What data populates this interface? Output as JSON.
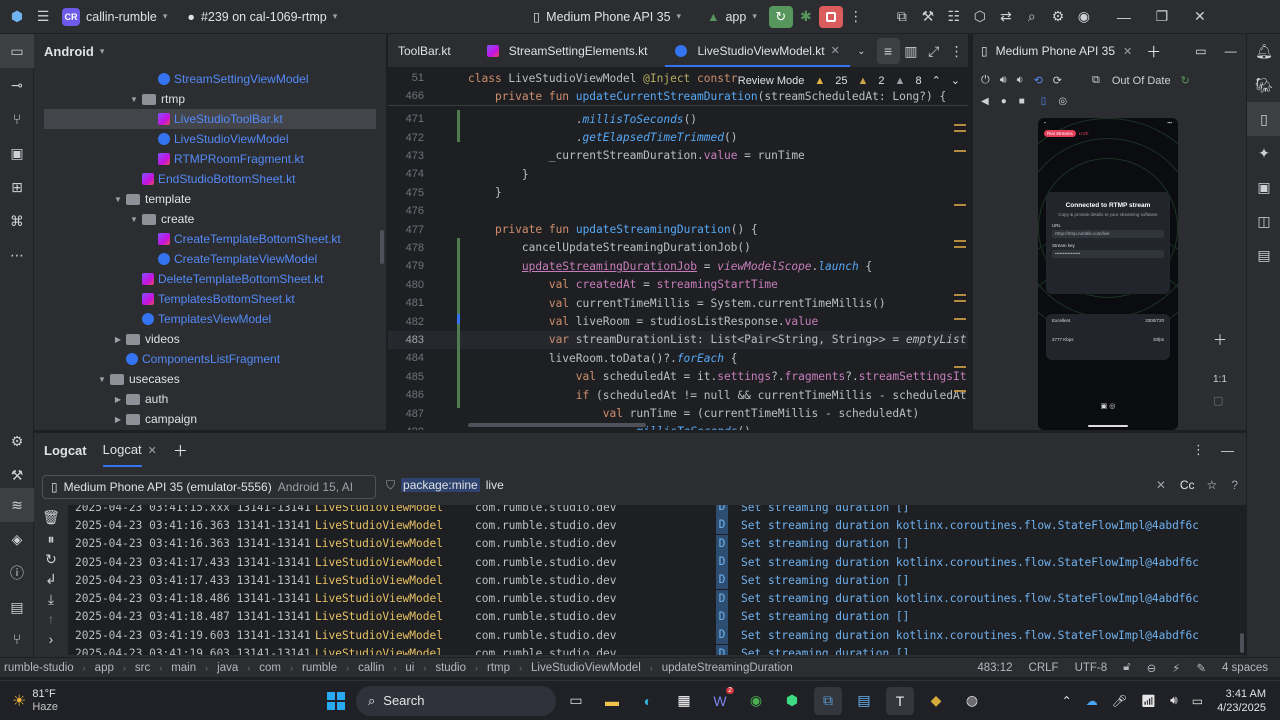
{
  "titlebar": {
    "project_badge": "CR",
    "project_name": "callin-rumble",
    "vcs": "#239 on cal-1069-rtmp",
    "device": "Medium Phone API 35",
    "run_config": "app",
    "window_buttons": [
      "minimize",
      "maximize",
      "close"
    ]
  },
  "project_panel": {
    "title": "Android",
    "tree": [
      {
        "label": "StreamSettingViewModel",
        "kind": "kt-class",
        "depth": 3,
        "selected": false
      },
      {
        "label": "rtmp",
        "kind": "folder",
        "depth": 2,
        "open": true
      },
      {
        "label": "LiveStudioToolBar.kt",
        "kind": "kt",
        "depth": 3,
        "selected": true
      },
      {
        "label": "LiveStudioViewModel",
        "kind": "kt-class",
        "depth": 3
      },
      {
        "label": "RTMPRoomFragment.kt",
        "kind": "kt",
        "depth": 3
      },
      {
        "label": "EndStudioBottomSheet.kt",
        "kind": "kt",
        "depth": 2
      },
      {
        "label": "template",
        "kind": "folder",
        "depth": 1,
        "open": true
      },
      {
        "label": "create",
        "kind": "folder",
        "depth": 2,
        "open": true
      },
      {
        "label": "CreateTemplateBottomSheet.kt",
        "kind": "kt",
        "depth": 3
      },
      {
        "label": "CreateTemplateViewModel",
        "kind": "kt-class",
        "depth": 3
      },
      {
        "label": "DeleteTemplateBottomSheet.kt",
        "kind": "kt",
        "depth": 2
      },
      {
        "label": "TemplatesBottomSheet.kt",
        "kind": "kt",
        "depth": 2
      },
      {
        "label": "TemplatesViewModel",
        "kind": "kt-class",
        "depth": 2
      },
      {
        "label": "videos",
        "kind": "folder",
        "depth": 1,
        "open": false
      },
      {
        "label": "ComponentsListFragment",
        "kind": "kt-class",
        "depth": 1
      },
      {
        "label": "usecases",
        "kind": "folder",
        "depth": 0,
        "open": true
      },
      {
        "label": "auth",
        "kind": "folder",
        "depth": 1,
        "open": false
      },
      {
        "label": "campaign",
        "kind": "folder",
        "depth": 1,
        "open": false
      }
    ]
  },
  "editor": {
    "tabs": [
      {
        "label": "ToolBar.kt",
        "active": false
      },
      {
        "label": "StreamSettingElements.kt",
        "active": false
      },
      {
        "label": "LiveStudioViewModel.kt",
        "active": true
      }
    ],
    "mode": "Review Mode",
    "warnings": "25",
    "weak_warnings": "2",
    "infos": "8",
    "sticky_lines": [
      {
        "n": "51",
        "text": "class LiveStudioViewModel @Inject constructor"
      },
      {
        "n": "466",
        "text": "    private fun updateCurrentStreamDuration(streamScheduledAt: Long?) {"
      }
    ],
    "lines": [
      {
        "n": "471",
        "text": "                .millisToSeconds()"
      },
      {
        "n": "472",
        "text": "                .getElapsedTimeTrimmed()"
      },
      {
        "n": "473",
        "text": "            _currentStreamDuration.value = runTime"
      },
      {
        "n": "474",
        "text": "        }"
      },
      {
        "n": "475",
        "text": "    }"
      },
      {
        "n": "476",
        "text": ""
      },
      {
        "n": "477",
        "text": "    private fun updateStreamingDuration() {"
      },
      {
        "n": "478",
        "text": "        cancelUpdateStreamingDurationJob()"
      },
      {
        "n": "479",
        "text": "        updateStreamingDurationJob = viewModelScope.launch {"
      },
      {
        "n": "480",
        "text": "            val createdAt = streamingStartTime"
      },
      {
        "n": "481",
        "text": "            val currentTimeMillis = System.currentTimeMillis()"
      },
      {
        "n": "482",
        "text": "            val liveRoom = studiosListResponse.value"
      },
      {
        "n": "483",
        "text": "            var streamDurationList: List<Pair<String, String>> = emptyList("
      },
      {
        "n": "484",
        "text": "            liveRoom.toData()?.forEach {"
      },
      {
        "n": "485",
        "text": "                val scheduledAt = it.settings?.fragments?.streamSettingsIt"
      },
      {
        "n": "486",
        "text": "                if (scheduledAt != null && currentTimeMillis - scheduledAt"
      },
      {
        "n": "487",
        "text": "                    val runTime = (currentTimeMillis - scheduledAt)"
      },
      {
        "n": "488",
        "text": "                        .millisToSeconds()"
      }
    ]
  },
  "device_panel": {
    "tab_label": "Medium Phone API 35",
    "status": "Out Of Date",
    "zoom_label": "1:1",
    "phone": {
      "header_pills": [
        "Rial Streams",
        "LIVE"
      ],
      "card_title": "Connected to RTMP stream",
      "card_sub": "Copy & provide details to your streaming software",
      "url_label": "URL",
      "url_value": "rtmp://rtmp.rumble.com/live",
      "key_label": "Stream key",
      "key_value": "••••••••••••••••",
      "stats": [
        {
          "label": "Excellent",
          "value": "3300/720"
        },
        {
          "label": "2777 Kbps",
          "value": "30fps"
        }
      ]
    }
  },
  "logcat": {
    "tabs": [
      "Logcat",
      "Logcat"
    ],
    "device_selector": "Medium Phone API 35 (emulator-5556)",
    "device_meta": "Android 15, AI",
    "filter_key": "package:mine",
    "filter_term": "live",
    "case_toggle": "Cc",
    "rows": [
      {
        "ts": "2025-04-23 03:41:15.xxx",
        "pid": "13141-13141",
        "tag": "LiveStudioViewModel",
        "pkg": "com.rumble.studio.dev",
        "lvl": "D",
        "msg": "Set streaming duration []"
      },
      {
        "ts": "2025-04-23 03:41:16.363",
        "pid": "13141-13141",
        "tag": "LiveStudioViewModel",
        "pkg": "com.rumble.studio.dev",
        "lvl": "D",
        "msg": "Set streaming duration kotlinx.coroutines.flow.StateFlowImpl@4abdf6c"
      },
      {
        "ts": "2025-04-23 03:41:16.363",
        "pid": "13141-13141",
        "tag": "LiveStudioViewModel",
        "pkg": "com.rumble.studio.dev",
        "lvl": "D",
        "msg": "Set streaming duration []"
      },
      {
        "ts": "2025-04-23 03:41:17.433",
        "pid": "13141-13141",
        "tag": "LiveStudioViewModel",
        "pkg": "com.rumble.studio.dev",
        "lvl": "D",
        "msg": "Set streaming duration kotlinx.coroutines.flow.StateFlowImpl@4abdf6c"
      },
      {
        "ts": "2025-04-23 03:41:17.433",
        "pid": "13141-13141",
        "tag": "LiveStudioViewModel",
        "pkg": "com.rumble.studio.dev",
        "lvl": "D",
        "msg": "Set streaming duration []"
      },
      {
        "ts": "2025-04-23 03:41:18.486",
        "pid": "13141-13141",
        "tag": "LiveStudioViewModel",
        "pkg": "com.rumble.studio.dev",
        "lvl": "D",
        "msg": "Set streaming duration kotlinx.coroutines.flow.StateFlowImpl@4abdf6c"
      },
      {
        "ts": "2025-04-23 03:41:18.487",
        "pid": "13141-13141",
        "tag": "LiveStudioViewModel",
        "pkg": "com.rumble.studio.dev",
        "lvl": "D",
        "msg": "Set streaming duration []"
      },
      {
        "ts": "2025-04-23 03:41:19.603",
        "pid": "13141-13141",
        "tag": "LiveStudioViewModel",
        "pkg": "com.rumble.studio.dev",
        "lvl": "D",
        "msg": "Set streaming duration kotlinx.coroutines.flow.StateFlowImpl@4abdf6c"
      },
      {
        "ts": "2025-04-23 03:41:19.603",
        "pid": "13141-13141",
        "tag": "LiveStudioViewModel",
        "pkg": "com.rumble.studio.dev",
        "lvl": "D",
        "msg": "Set streaming duration []"
      }
    ]
  },
  "statusbar": {
    "breadcrumbs": [
      "rumble-studio",
      "app",
      "src",
      "main",
      "java",
      "com",
      "rumble",
      "callin",
      "ui",
      "studio",
      "rtmp",
      "LiveStudioViewModel",
      "updateStreamingDuration"
    ],
    "position": "483:12",
    "line_sep": "CRLF",
    "encoding": "UTF-8",
    "indent": "4 spaces"
  },
  "taskbar": {
    "weather_temp": "81°F",
    "weather_cond": "Haze",
    "search_placeholder": "Search",
    "time": "3:41 AM",
    "date": "4/23/2025",
    "teams_badge": "2"
  },
  "colors": {
    "accent": "#3574f0",
    "panel_bg": "#2b2d30",
    "editor_bg": "#1e1f22",
    "log_tag": "#e7c265",
    "log_debug": "#6fb2f0",
    "run_green": "#57965c",
    "stop_red": "#db5c5c"
  }
}
